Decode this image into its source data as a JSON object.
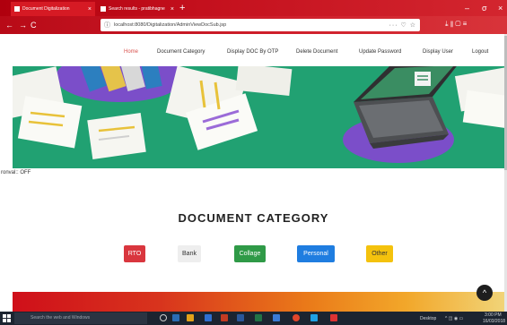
{
  "browser": {
    "tabs": [
      {
        "label": "Document Digitalization",
        "active": true
      },
      {
        "label": "Search results - pratibhagne",
        "active": false
      }
    ],
    "new_tab": "+",
    "url": "localhost:8080/Digitalization/AdminViewDocSub.jsp",
    "url_tools": "··· ♡ ☆",
    "nav": {
      "back": "←",
      "forward": "→",
      "reload": "C"
    },
    "right_tools": "⤓  ⫴  ▢  ≡",
    "window_controls": {
      "minimize": "–",
      "maximize": "σ",
      "close": "×"
    }
  },
  "site": {
    "nav": [
      {
        "label": "Home",
        "active": true
      },
      {
        "label": "Document Category",
        "active": false
      },
      {
        "label": "Display DOC By OTP",
        "active": false
      },
      {
        "label": "Delete Document",
        "active": false
      },
      {
        "label": "Update Password",
        "active": false
      },
      {
        "label": "Display User",
        "active": false
      },
      {
        "label": "Logout",
        "active": false
      }
    ]
  },
  "interval_text": "ronval:: OFF",
  "section_title": "DOCUMENT CATEGORY",
  "categories": [
    {
      "label": "RTO",
      "bg": "#d9363e",
      "fg": "#ffffff"
    },
    {
      "label": "Bank",
      "bg": "#eeeeee",
      "fg": "#333333"
    },
    {
      "label": "Collage",
      "bg": "#2f9a47",
      "fg": "#ffffff"
    },
    {
      "label": "Personal",
      "bg": "#1f7de0",
      "fg": "#ffffff"
    },
    {
      "label": "Other",
      "bg": "#f4c20d",
      "fg": "#333333"
    }
  ],
  "scroll_top": "^",
  "taskbar": {
    "search_placeholder": "Search the web and Windows",
    "desktop": "Desktop",
    "tray": "^ ◫ ◉ ▭",
    "time": "3:00 PM",
    "date": "16/03/2018"
  },
  "colors": {
    "accent": "#c4101d",
    "hero_bg": "#1f9a6d"
  }
}
